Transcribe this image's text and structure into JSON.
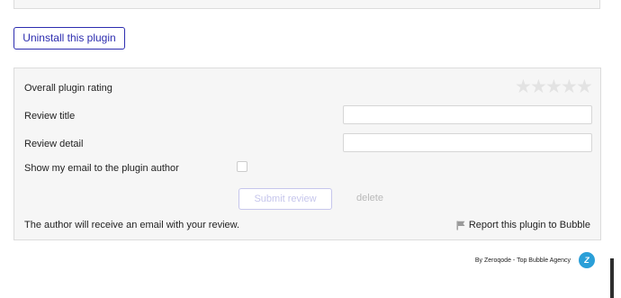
{
  "uninstall_button": "Uninstall this plugin",
  "rating_form": {
    "overall_rating_label": "Overall plugin rating",
    "rating_value": 0,
    "rating_max": 5,
    "review_title_label": "Review title",
    "review_title_value": "",
    "review_detail_label": "Review detail",
    "review_detail_value": "",
    "show_email_label": "Show my email to the plugin author",
    "show_email_checked": false,
    "submit_label": "Submit review",
    "delete_label": "delete",
    "info_text": "The author will receive an email with your review.",
    "report_label": "Report this plugin to Bubble"
  },
  "footer": {
    "credit": "By Zeroqode - Top Bubble Agency"
  },
  "colors": {
    "accent": "#2d2daf",
    "disabled_accent": "#c6c6ec",
    "panel_bg": "#f6f6f6",
    "star_empty": "#e3e3e3",
    "logo": "#2a9fd8"
  },
  "icons": {
    "star": "star-icon",
    "flag": "flag-icon",
    "logo": "zeroqode-logo"
  }
}
